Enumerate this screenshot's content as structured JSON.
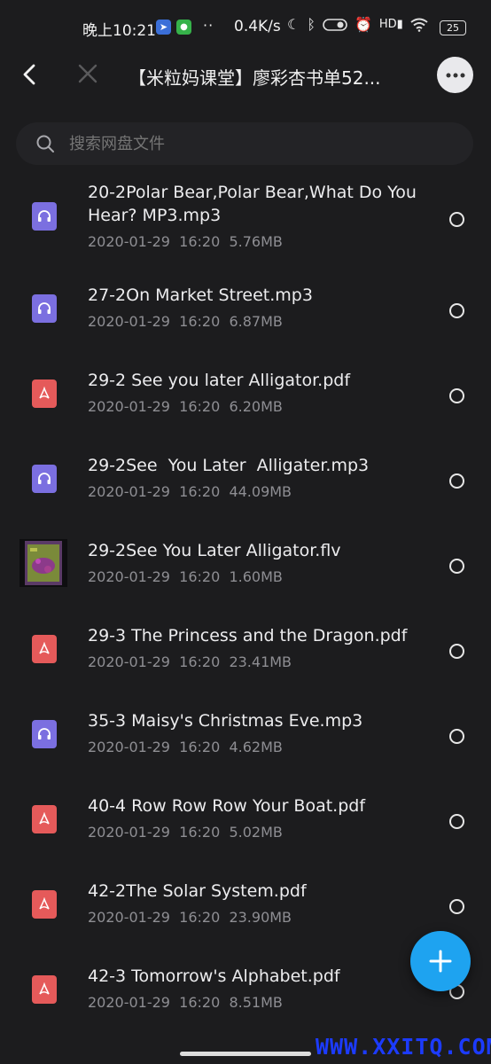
{
  "status_bar": {
    "time": "晚上10:21",
    "dots": "··",
    "net_speed": "0.4K/s",
    "battery": "25",
    "hd_label": "HD"
  },
  "header": {
    "title": "【米粒妈课堂】廖彩杏书单52..."
  },
  "search": {
    "placeholder": "搜索网盘文件"
  },
  "files": [
    {
      "name": "20-2Polar Bear,Polar Bear,What Do You Hear? MP3.mp3",
      "date": "2020-01-29",
      "time": "16:20",
      "size": "5.76MB",
      "type": "audio"
    },
    {
      "name": "27-2On Market Street.mp3",
      "date": "2020-01-29",
      "time": "16:20",
      "size": "6.87MB",
      "type": "audio"
    },
    {
      "name": "29-2 See you later Alligator.pdf",
      "date": "2020-01-29",
      "time": "16:20",
      "size": "6.20MB",
      "type": "pdf"
    },
    {
      "name": "29-2See  You Later  Alligater.mp3",
      "date": "2020-01-29",
      "time": "16:20",
      "size": "44.09MB",
      "type": "audio"
    },
    {
      "name": "29-2See You Later Alligator.flv",
      "date": "2020-01-29",
      "time": "16:20",
      "size": "1.60MB",
      "type": "video"
    },
    {
      "name": "29-3 The Princess and the Dragon.pdf",
      "date": "2020-01-29",
      "time": "16:20",
      "size": "23.41MB",
      "type": "pdf"
    },
    {
      "name": "35-3 Maisy's Christmas Eve.mp3",
      "date": "2020-01-29",
      "time": "16:20",
      "size": "4.62MB",
      "type": "audio"
    },
    {
      "name": "40-4 Row Row Row Your Boat.pdf",
      "date": "2020-01-29",
      "time": "16:20",
      "size": "5.02MB",
      "type": "pdf"
    },
    {
      "name": "42-2The Solar System.pdf",
      "date": "2020-01-29",
      "time": "16:20",
      "size": "23.90MB",
      "type": "pdf"
    },
    {
      "name": "42-3 Tomorrow's Alphabet.pdf",
      "date": "2020-01-29",
      "time": "16:20",
      "size": "8.51MB",
      "type": "pdf"
    }
  ],
  "watermark": "WWW.XXITQ.COM",
  "colors": {
    "background": "#1c1c1e",
    "audio_icon": "#7b6fe0",
    "pdf_icon": "#e55a5a",
    "fab": "#1ea3f0"
  }
}
